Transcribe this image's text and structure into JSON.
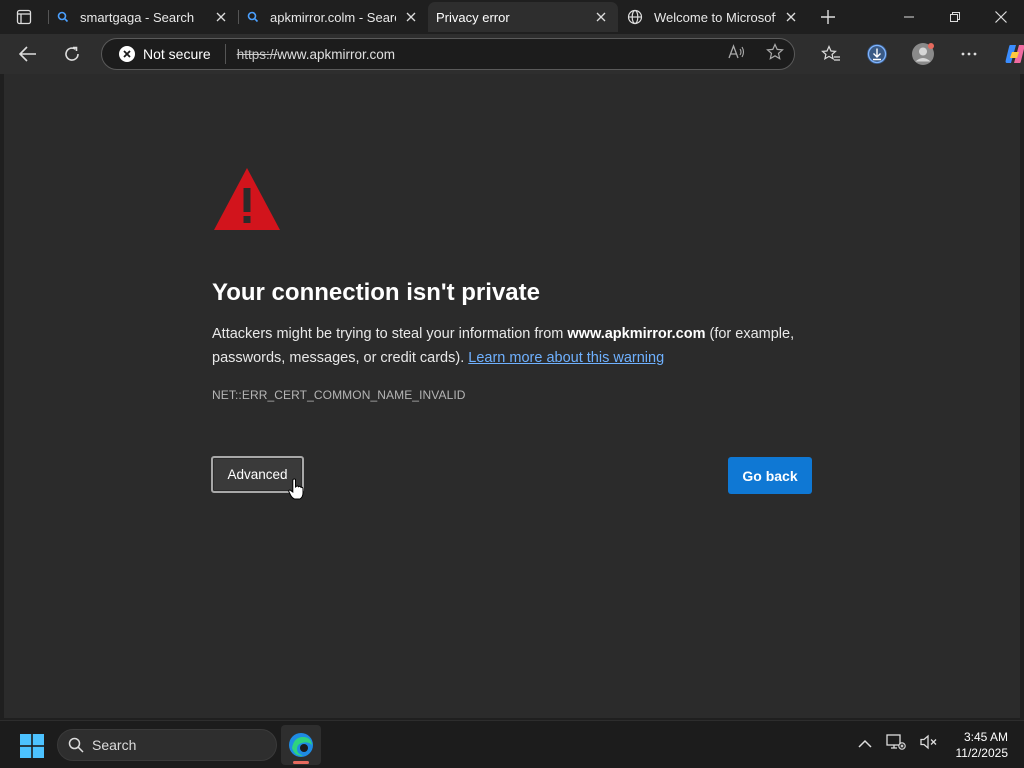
{
  "tabs": [
    {
      "title": "smartgaga - Search",
      "favicon": "search-icon",
      "active": false
    },
    {
      "title": "apkmirror.colm - Search",
      "favicon": "search-icon",
      "active": false
    },
    {
      "title": "Privacy error",
      "favicon": "",
      "active": true
    },
    {
      "title": "Welcome to Microsoft E",
      "favicon": "globe-icon",
      "active": false
    }
  ],
  "addressbar": {
    "security_label": "Not secure",
    "url_scheme": "https://",
    "url_host": "www.apkmirror.com"
  },
  "page": {
    "heading": "Your connection isn't private",
    "desc_prefix": "Attackers might be trying to steal your information from ",
    "desc_domain": "www.apkmirror.com",
    "desc_suffix": " (for example, passwords, messages, or credit cards). ",
    "learn_more": "Learn more about this warning",
    "error_code": "NET::ERR_CERT_COMMON_NAME_INVALID",
    "advanced_label": "Advanced",
    "go_back_label": "Go back"
  },
  "taskbar": {
    "search_label": "Search",
    "time": "3:45 AM",
    "date": "11/2/2025"
  },
  "colors": {
    "accent": "#0f78d4",
    "link": "#6fb1ff",
    "warning_red": "#d2141c"
  }
}
